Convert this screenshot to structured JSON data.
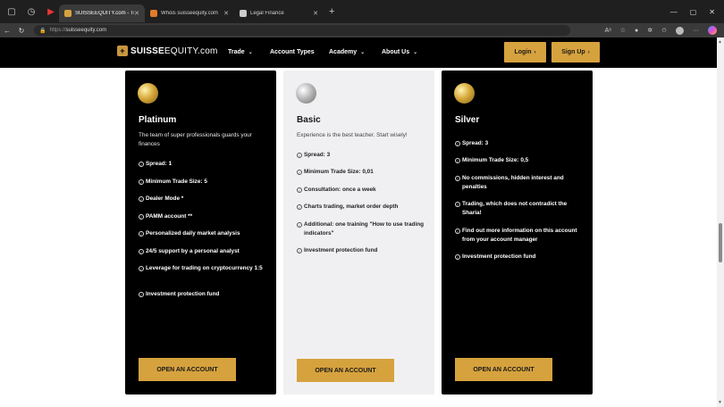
{
  "browser": {
    "tabs": [
      {
        "title": "SUISSEEQUITY.com - Trading Pla",
        "active": true,
        "favicon_color": "#d6a23e"
      },
      {
        "title": "Whois suisseequity.com",
        "active": false,
        "favicon_color": "#e07b2a"
      },
      {
        "title": "Legal Finance",
        "active": false,
        "favicon_color": "#cccccc"
      }
    ],
    "url_prefix": "https://",
    "url_host": "suisseequity.com"
  },
  "header": {
    "logo_bold": "SUISSE",
    "logo_rest": "EQUITY.com",
    "nav": [
      "Trade",
      "Account Types",
      "Academy",
      "About Us"
    ],
    "login_label": "Login",
    "signup_label": "Sign Up"
  },
  "plans": [
    {
      "title": "Platinum",
      "coin": "gold",
      "theme": "dark",
      "description": "The team of super professionals guards your finances",
      "features": [
        "Spread: 1",
        "Minimum Trade Size: 5",
        "Dealer Mode *",
        "PAMM account **",
        "Personalized daily market analysis",
        "24/5 support by a personal analyst",
        "Leverage for trading on cryptocurrency 1:5",
        "Investment protection fund"
      ],
      "button": "OPEN AN ACCOUNT"
    },
    {
      "title": "Basic",
      "coin": "silver",
      "theme": "light",
      "description": "Experience is the best teacher. Start wisely!",
      "features": [
        "Spread: 3",
        "Minimum Trade Size: 0,01",
        "Consultation: once a week",
        "Charts trading, market order depth",
        "Additional: one training \"How to use trading indicators\"",
        "Investment protection fund"
      ],
      "button": "OPEN AN ACCOUNT"
    },
    {
      "title": "Silver",
      "coin": "gold",
      "theme": "dark",
      "description": "",
      "features": [
        "Spread: 3",
        "Minimum Trade Size: 0,5",
        "No commissions, hidden interest and penalties",
        "Trading, which does not contradict the Sharia!",
        "Find out more information on this account from your account manager",
        "Investment protection fund"
      ],
      "button": "OPEN AN ACCOUNT"
    }
  ],
  "colors": {
    "accent_gold": "#d6a23e",
    "card_dark": "#000000",
    "card_light": "#f0f0f2"
  }
}
